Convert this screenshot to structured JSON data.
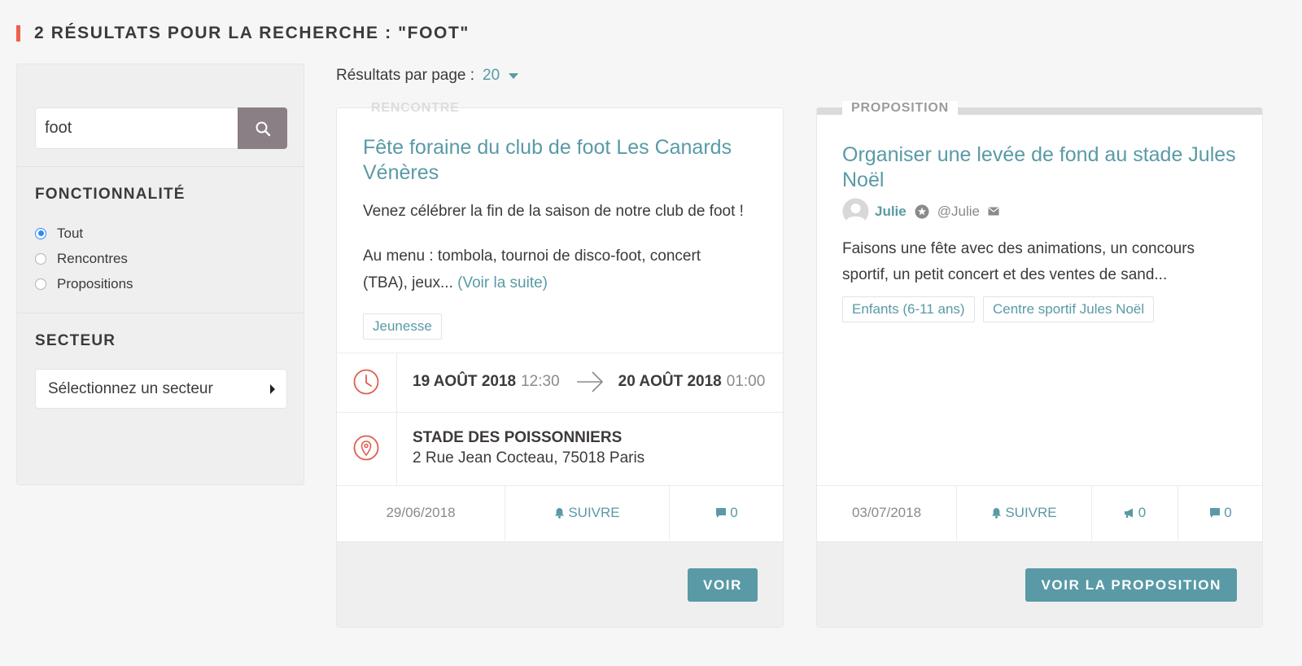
{
  "page": {
    "title": "2 RÉSULTATS POUR LA RECHERCHE : \"FOOT\""
  },
  "sidebar": {
    "search": {
      "value": "foot",
      "placeholder": "",
      "icon": "search-icon"
    },
    "features": {
      "heading": "FONCTIONNALITÉ",
      "options": [
        {
          "label": "Tout",
          "checked": true
        },
        {
          "label": "Rencontres",
          "checked": false
        },
        {
          "label": "Propositions",
          "checked": false
        }
      ]
    },
    "sector": {
      "heading": "SECTEUR",
      "select_label": "Sélectionnez un secteur"
    }
  },
  "results_per_page": {
    "label": "Résultats par page :",
    "value": "20"
  },
  "cards": [
    {
      "type_label": "RENCONTRE",
      "title": "Fête foraine du club de foot Les Canards Vénères",
      "description_1": "Venez célébrer la fin de la saison de notre club de foot !",
      "description_2": "Au menu : tombola, tournoi de disco-foot, concert (TBA), jeux...",
      "read_more": "(Voir la suite)",
      "tags": [
        "Jeunesse"
      ],
      "start_date": "19 AOÛT 2018",
      "start_time": "12:30",
      "end_date": "20 AOÛT 2018",
      "end_time": "01:00",
      "venue_name": "STADE DES POISSONNIERS",
      "venue_address": "2 Rue Jean Cocteau, 75018 Paris",
      "footer": {
        "date": "29/06/2018",
        "follow": "SUIVRE",
        "comments": "0"
      },
      "button": "VOIR"
    },
    {
      "type_label": "PROPOSITION",
      "title": "Organiser une levée de fond au stade Jules Noël",
      "author_name": "Julie",
      "author_handle": "@Julie",
      "description": "Faisons une fête avec des animations, un concours sportif, un petit concert et des ventes de sand...",
      "tags": [
        "Enfants (6-11 ans)",
        "Centre sportif Jules Noël"
      ],
      "footer": {
        "date": "03/07/2018",
        "follow": "SUIVRE",
        "endorsements": "0",
        "comments": "0"
      },
      "button": "VOIR LA PROPOSITION"
    }
  ],
  "colors": {
    "accent": "#599aa6",
    "title_mark": "#ef604d",
    "search_button": "#8a7f85",
    "icon_red": "#e05d4b"
  }
}
